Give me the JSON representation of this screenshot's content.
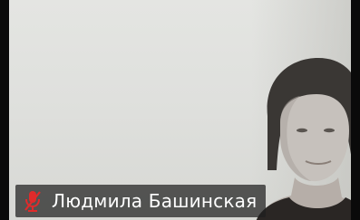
{
  "participant": {
    "name": "Людмила Башинская",
    "mic_icon": "mic-muted-icon",
    "mic_icon_color": "#e02b2b"
  }
}
